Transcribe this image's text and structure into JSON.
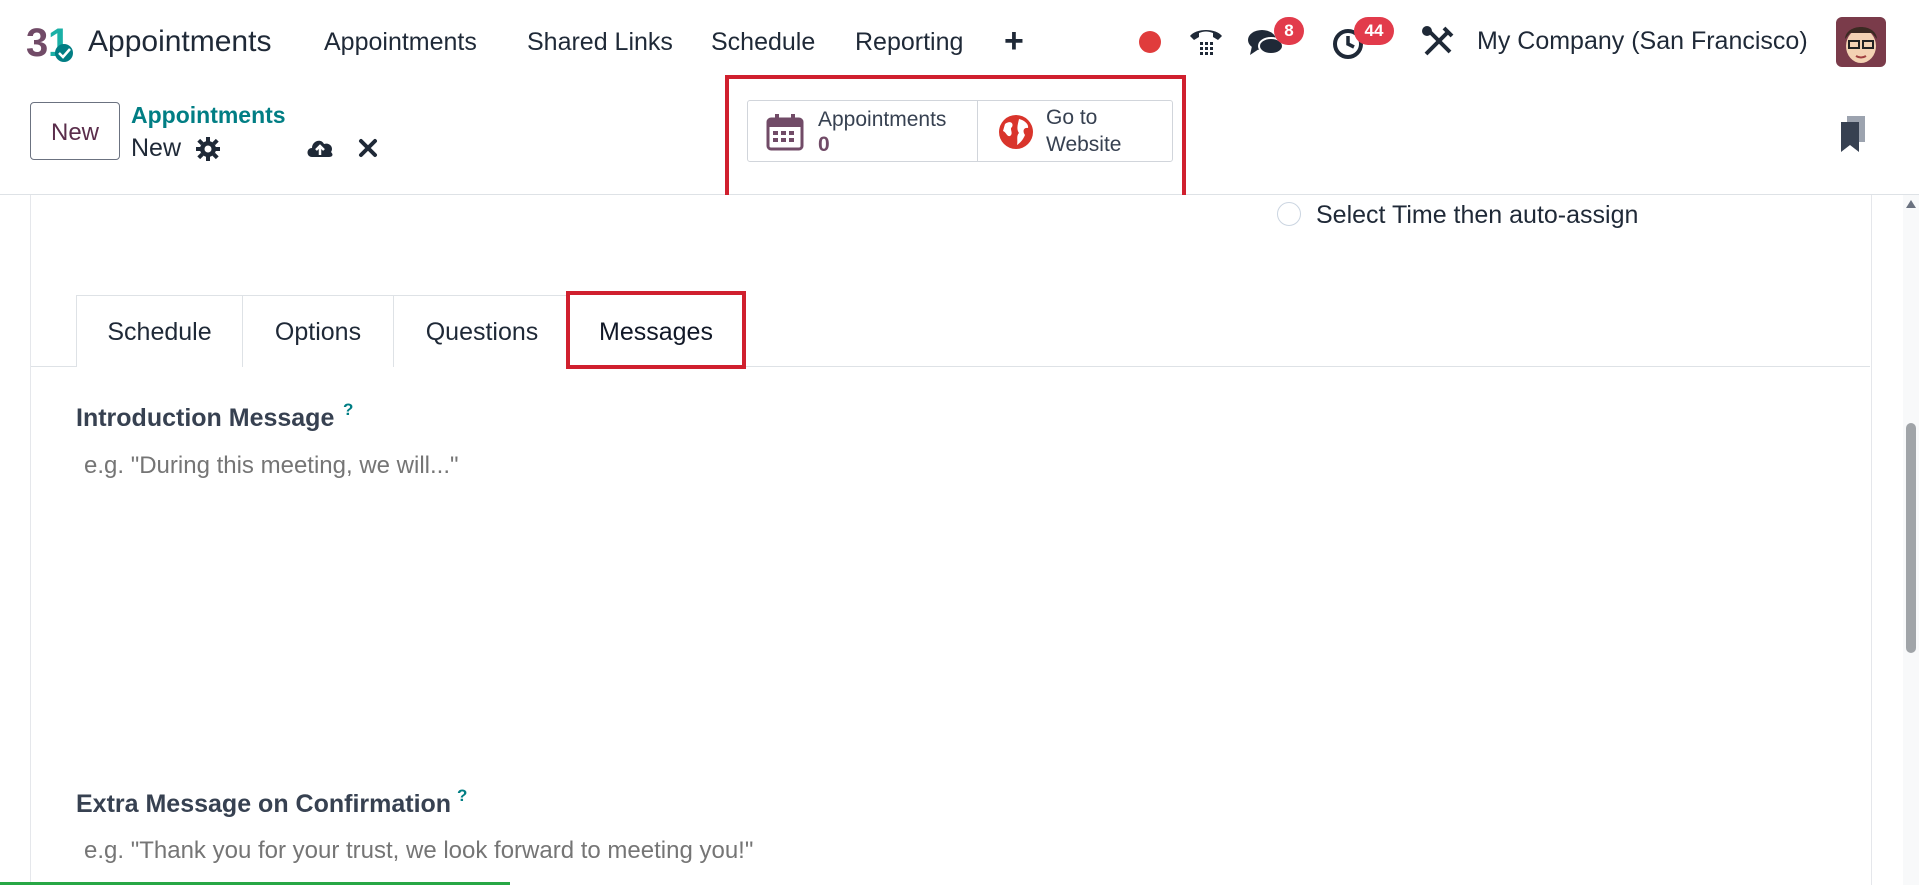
{
  "navbar": {
    "app_title": "Appointments",
    "menu": [
      "Appointments",
      "Shared Links",
      "Schedule",
      "Reporting"
    ],
    "chat_badge": "8",
    "activity_badge": "44",
    "company": "My Company (San Francisco)"
  },
  "control_panel": {
    "new_label": "New",
    "breadcrumb_parent": "Appointments",
    "breadcrumb_current": "New",
    "smart_buttons": {
      "appointments_label": "Appointments",
      "appointments_count": "0",
      "website_line1": "Go to",
      "website_line2": "Website"
    }
  },
  "form": {
    "radio_option": "Select Time then auto-assign",
    "tabs": [
      "Schedule",
      "Options",
      "Questions",
      "Messages"
    ],
    "active_tab": "Messages",
    "intro_label": "Introduction Message",
    "intro_placeholder": "e.g. \"During this meeting, we will...\"",
    "confirm_label": "Extra Message on Confirmation",
    "confirm_placeholder": "e.g. \"Thank you for your trust, we look forward to meeting you!\"",
    "help_mark": "?"
  },
  "colors": {
    "accent": "#017e84",
    "highlight": "#d0202e",
    "badge": "#e23b4b",
    "brand": "#714b67"
  }
}
